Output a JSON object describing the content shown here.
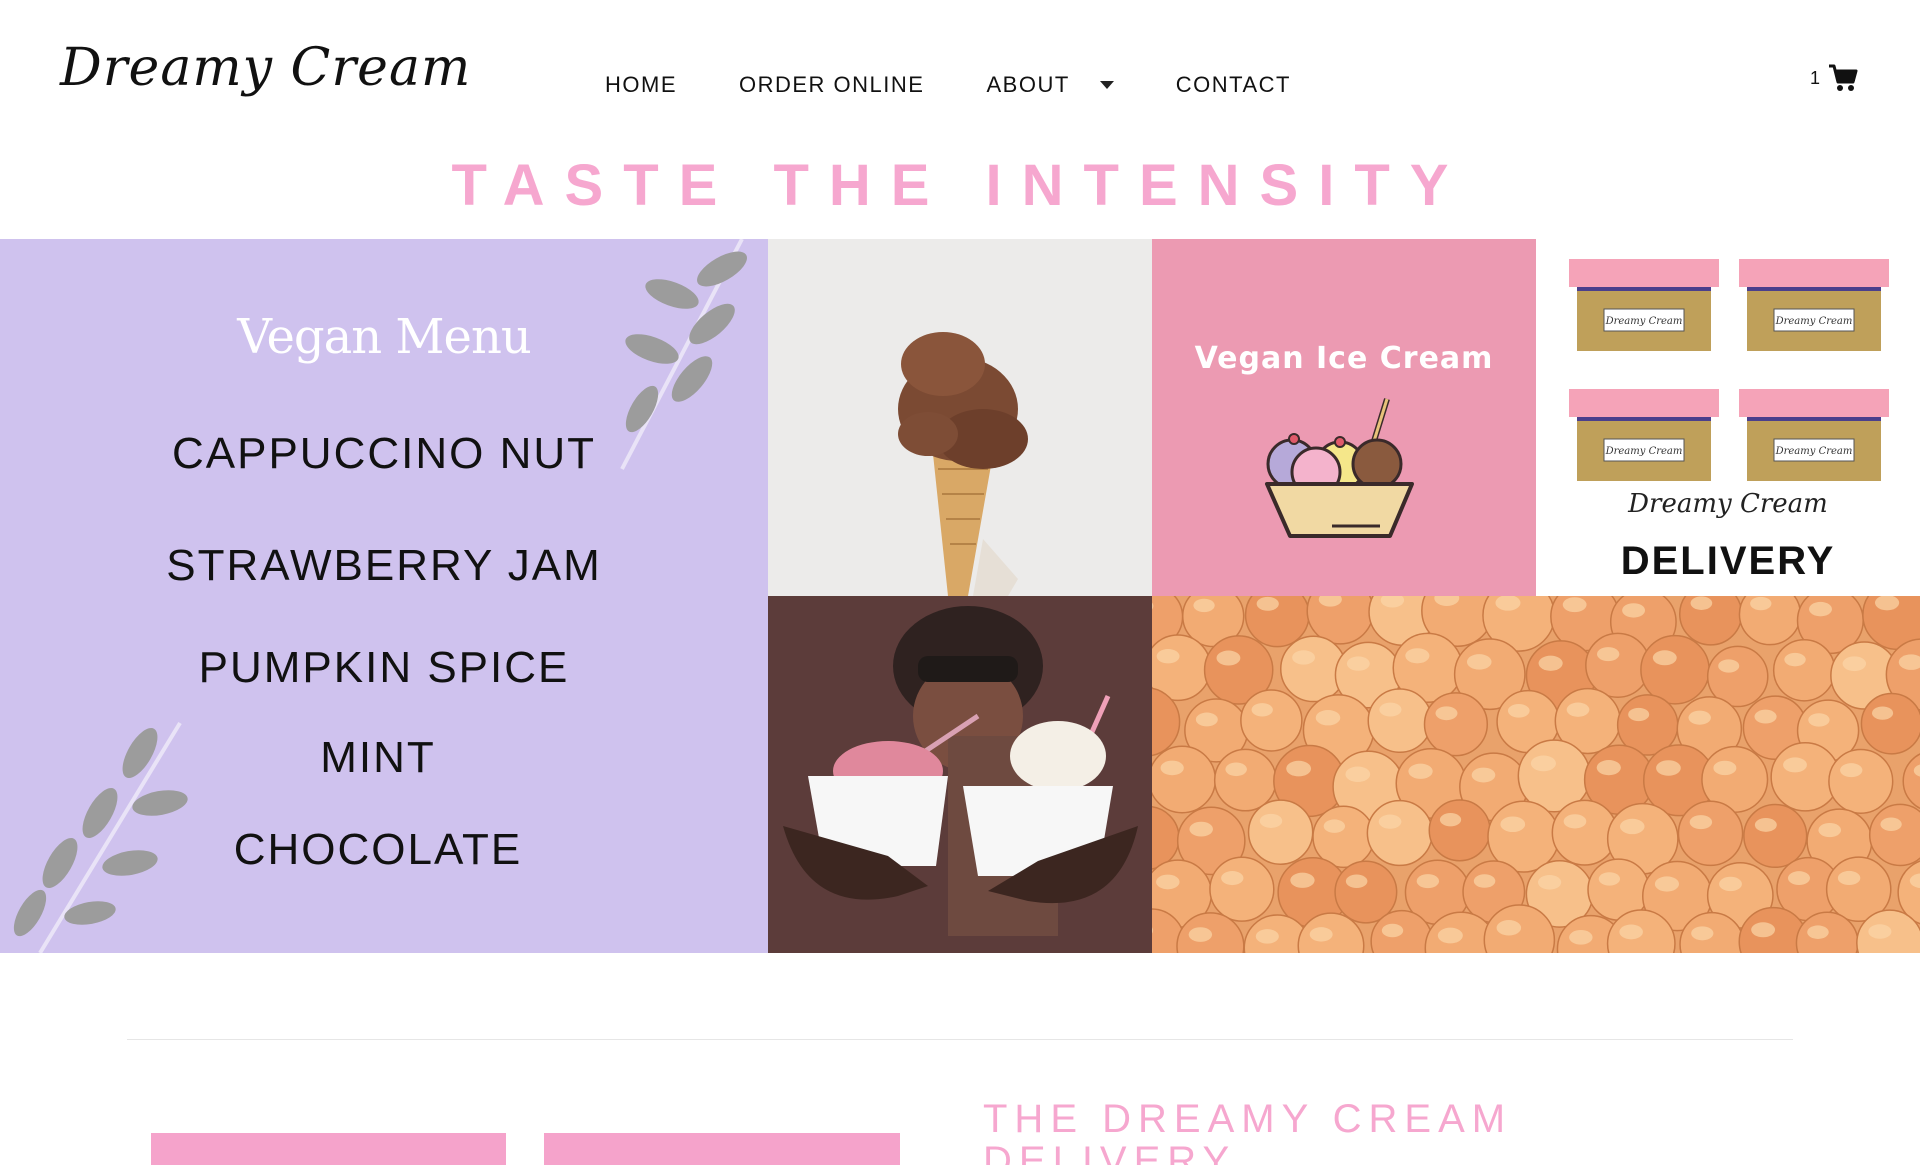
{
  "header": {
    "logo_text": "Dreamy Cream",
    "nav": {
      "home": "HOME",
      "order_online": "ORDER ONLINE",
      "about": "ABOUT",
      "contact": "CONTACT"
    },
    "cart_count": "1"
  },
  "hero": {
    "title": "TASTE THE INTENSITY"
  },
  "gallery": {
    "vegan_menu": {
      "title": "Vegan Menu",
      "items": [
        "CAPPUCCINO NUT",
        "STRAWBERRY JAM",
        "PUMPKIN SPICE",
        "MINT",
        "CHOCOLATE"
      ]
    },
    "vegan_ice_cream": {
      "title": "Vegan Ice Cream"
    },
    "delivery": {
      "brand": "Dreamy Cream",
      "word": "DELIVERY",
      "box_label": "Dreamy Cream"
    }
  },
  "lower": {
    "section_title": "THE DREAMY CREAM DELIVERY"
  },
  "colors": {
    "accent_pink": "#f6a7cf",
    "menu_lavender": "#cfc2ee",
    "tile_pink": "#ec9ab2"
  },
  "icons": {
    "cart": "cart-icon",
    "about_caret": "chevron-down-icon"
  }
}
